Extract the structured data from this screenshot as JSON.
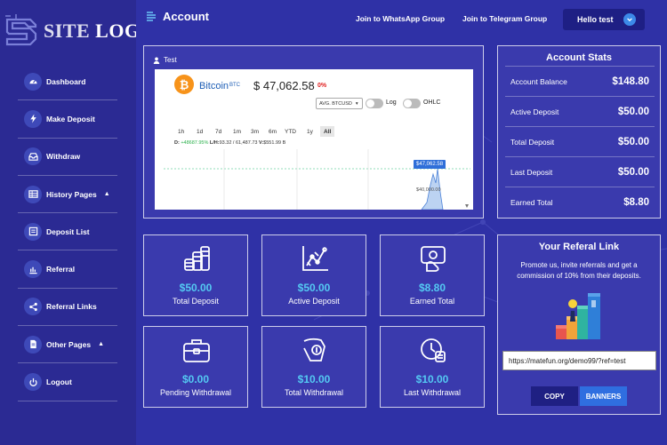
{
  "logo": {
    "text_a": "SITE",
    "text_b": " LOGO"
  },
  "sidebar": {
    "items": [
      {
        "label": "Dashboard",
        "icon": "gauge-icon"
      },
      {
        "label": "Make Deposit",
        "icon": "bolt-icon"
      },
      {
        "label": "Withdraw",
        "icon": "tray-icon"
      },
      {
        "label": "History Pages",
        "icon": "table-icon",
        "caret": "▲"
      },
      {
        "label": "Deposit List",
        "icon": "list-icon"
      },
      {
        "label": "Referral",
        "icon": "bar-chart-icon"
      },
      {
        "label": "Referral Links",
        "icon": "share-icon"
      },
      {
        "label": "Other Pages",
        "icon": "document-icon",
        "caret": "▲"
      },
      {
        "label": "Logout",
        "icon": "power-icon"
      }
    ]
  },
  "header": {
    "title": "Account",
    "whatsapp": "Join to WhatsApp Group",
    "telegram": "Join to Telegram Group",
    "user_button": "Hello test"
  },
  "widget": {
    "label": "Test",
    "coin_name": "Bitcoin",
    "coin_symbol": "BTC",
    "price": "$ 47,062.58",
    "change": "0%",
    "pair": "AVG. BTCUSD",
    "log_label": "Log",
    "ohlc_label": "OHLC",
    "ranges": [
      "1h",
      "1d",
      "7d",
      "1m",
      "3m",
      "6m",
      "YTD",
      "1y",
      "All"
    ],
    "active_range": "All",
    "ohlc": {
      "d_label": "D:",
      "d_value": "+48687.95%",
      "lh_label": "L/H:",
      "lh_value": "93.32 / 61,487.73",
      "v_label": "V:",
      "v_value": "$551.99 B"
    },
    "price_tag": "$47,062.58",
    "axis_tag": "$40,000.00"
  },
  "stats": [
    {
      "value": "$50.00",
      "label": "Total Deposit",
      "icon": "coins-icon"
    },
    {
      "value": "$50.00",
      "label": "Active Deposit",
      "icon": "trend-chart-icon"
    },
    {
      "value": "$8.80",
      "label": "Earned Total",
      "icon": "money-hand-icon"
    },
    {
      "value": "$0.00",
      "label": "Pending Withdrawal",
      "icon": "briefcase-icon"
    },
    {
      "value": "$10.00",
      "label": "Total Withdrawal",
      "icon": "hand-coin-icon"
    },
    {
      "value": "$10.00",
      "label": "Last Withdrawal",
      "icon": "clock-coin-icon"
    }
  ],
  "account_stats": {
    "title": "Account Stats",
    "rows": [
      {
        "label": "Account Balance",
        "value": "$148.80"
      },
      {
        "label": "Active Deposit",
        "value": "$50.00"
      },
      {
        "label": "Total Deposit",
        "value": "$50.00"
      },
      {
        "label": "Last Deposit",
        "value": "$50.00"
      },
      {
        "label": "Earned Total",
        "value": "$8.80"
      }
    ]
  },
  "referral": {
    "title": "Your Referal Link",
    "description": "Promote us, invite referrals and get a commission of 10% from their deposits.",
    "link": "https://matefun.org/demo99/?ref=test",
    "copy": "COPY",
    "banners": "BANNERS"
  },
  "colors": {
    "accent": "#54c9f2",
    "sidebar": "#2b2a93",
    "main": "#2f31a6",
    "button_blue": "#2f6ee0",
    "bitcoin": "#f7931a"
  }
}
